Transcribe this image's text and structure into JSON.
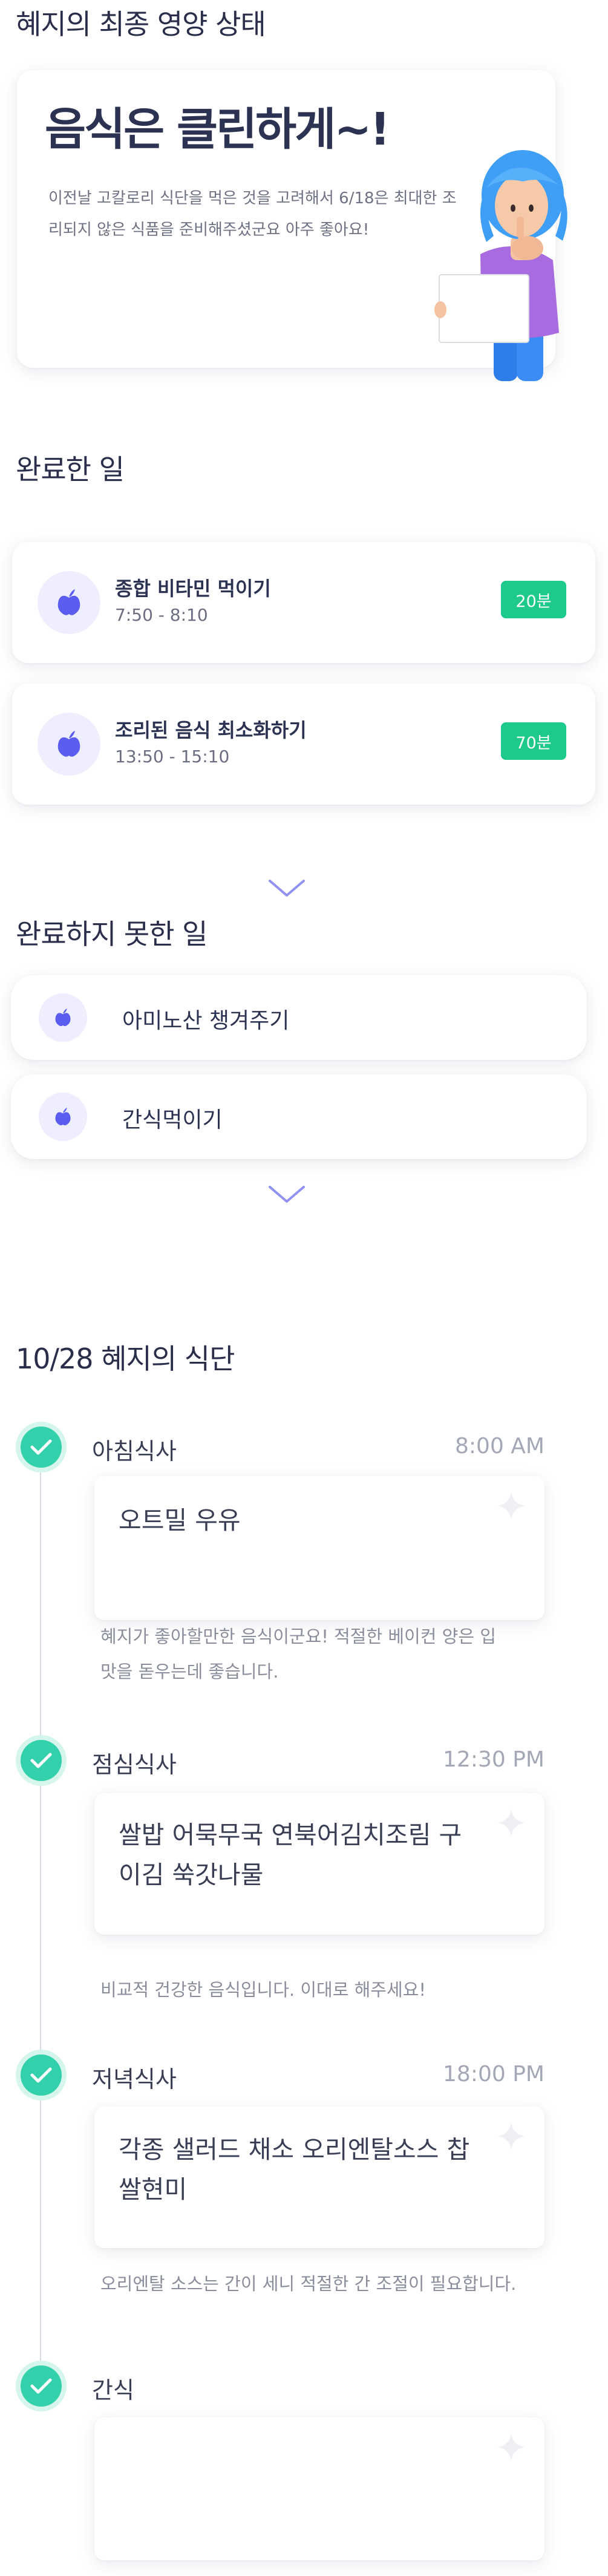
{
  "nutrition": {
    "title": "혜지의 최종 영양 상태",
    "headline": "음식은 클린하게~!",
    "description": "이전날 고칼로리 식단을 먹은 것을 고려해서 6/18은 최대한 조리되지 않은 식품을 준비해주셨군요 아주 좋아요!"
  },
  "completed": {
    "title": "완료한 일",
    "tasks": [
      {
        "title": "종합 비타민 먹이기",
        "time": "7:50 - 8:10",
        "duration": "20분",
        "icon": "apple-icon"
      },
      {
        "title": "조리된 음식 최소화하기",
        "time": "13:50 - 15:10",
        "duration": "70분",
        "icon": "apple-icon"
      }
    ]
  },
  "incomplete": {
    "title": "완료하지 못한 일",
    "tasks": [
      {
        "label": "아미노산 챙겨주기",
        "icon": "apple-icon"
      },
      {
        "label": "간식먹이기",
        "icon": "apple-icon"
      }
    ]
  },
  "diet": {
    "title": "10/28 혜지의 식단",
    "meals": [
      {
        "name": "아침식사",
        "time": "8:00 AM",
        "food": "오트밀 우유",
        "note": "혜지가 좋아할만한 음식이군요! 적절한 베이컨 양은 입맛을 돋우는데 좋습니다."
      },
      {
        "name": "점심식사",
        "time": "12:30 PM",
        "food": "쌀밥 어묵무국 연북어김치조림 구이김 쑥갓나물",
        "note": "비교적 건강한 음식입니다. 이대로 해주세요!"
      },
      {
        "name": "저녁식사",
        "time": "18:00 PM",
        "food": "각종 샐러드 채소 오리엔탈소스 찹쌀현미",
        "note": "오리엔탈 소스는 간이 세니 적절한 간 조절이 필요합니다."
      },
      {
        "name": "간식",
        "time": "",
        "food": "",
        "note": ""
      }
    ]
  },
  "colors": {
    "accent_purple": "#5b5cf0",
    "badge_green": "#1ec98c",
    "check_teal": "#33d1ab"
  }
}
